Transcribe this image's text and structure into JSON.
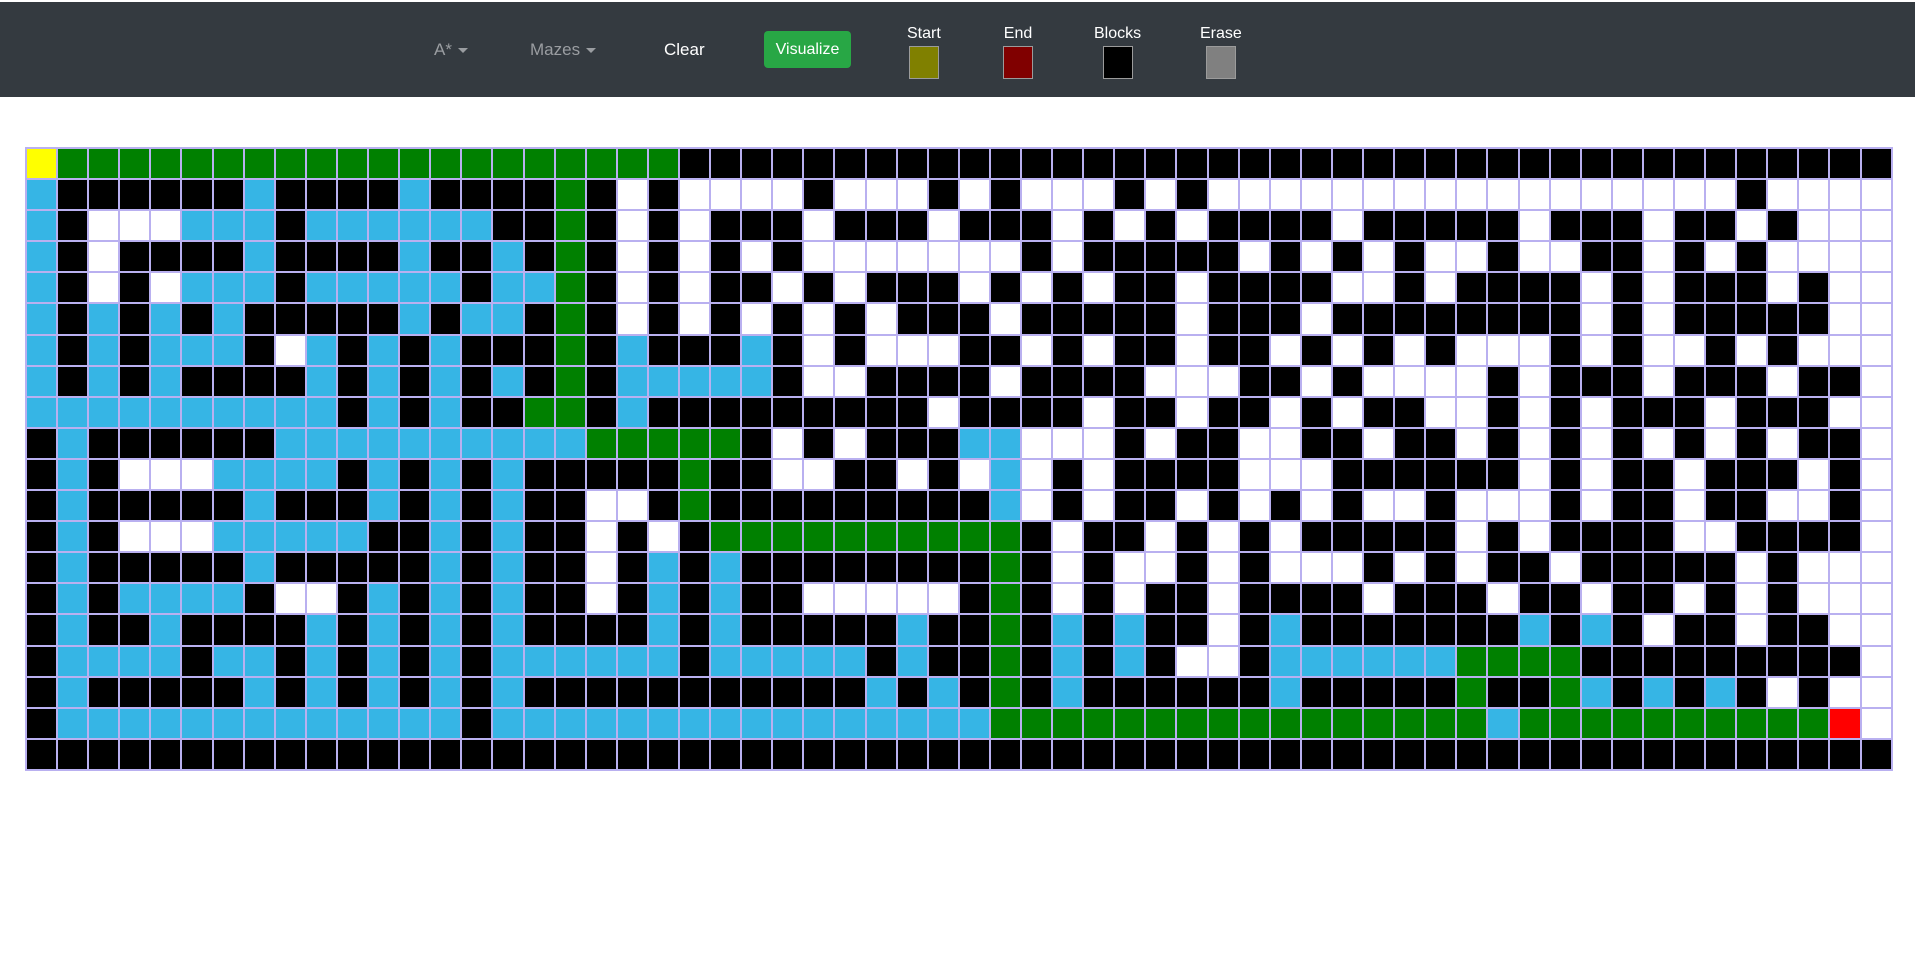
{
  "nav": {
    "algorithm_label": "A*",
    "mazes_label": "Mazes",
    "clear_label": "Clear",
    "visualize_label": "Visualize"
  },
  "legend": [
    {
      "label": "Start",
      "color": "#808000"
    },
    {
      "label": "End",
      "color": "#800000"
    },
    {
      "label": "Blocks",
      "color": "#000000"
    },
    {
      "label": "Erase",
      "color": "#808080"
    }
  ],
  "grid": {
    "cols": 60,
    "colors": {
      "S": "#ffff00",
      "E": "#ff0000",
      "P": "#008000",
      "V": "#36b5e5",
      "W": "#000000",
      ".": "#ffffff"
    },
    "rows": [
      "SPPPPPPPPPPPPPPPPPPPPWWWWWWWWWWWWWWWWWWWWWWWWWWWWWWWWWWWWWWW",
      "VWWWWWWVWWWWVWWWWPW.W....W...W.W...W.W.................W....",
      "VW...VVVWVVVVVVWWPW.W.WWW.WWW.WWW.W.W.WWWW.WWWWW.WWW.WW.W...",
      "VW.WWWWVWWWWVWWVWPW.W.W.W.......W.WWWWW.W.W.W..W..WW.W.W....",
      "VW.W.VVVWVVVVVWVVPW.W.WW.W.WWW.W.W.WW.WWWW..W.WWWW.W.WWW.W..",
      "VWVWVWVWWWWWVWVVWPW.W.W.W.W.WWW.WWWWW.WWW.WWWWWWWW.W.WWWWW..",
      "VWVWVVVW.VWVWVWWWPWVWWWVW.W...WW.W.WW.WW.W.W.W...W.W..W.W...",
      "VWVWVWWWWVWVWVWVWPWVVVVVW..WWWW.WWWW...WW.W....W.WWW.WWW.WW.",
      "VVVVVVVVVVWVWVWWPPWVWWWWWWWWW.WWWW.WW.WW.W.WW..W.W.WWW.WWW..",
      "WVWWWWWWVVVVVVVVVVPPPPPW.W.WWWVV...W.WW..WW.WW.W.W.W.W.W.WW.",
      "WVW...VVVVWVWVWVWWWWWPWW..WW.W.V.W.WWWW...WWWWWW.W.WW.WWW.W.",
      "WVWWWWWVWWWVWVWVWW..WPWWWWWWWWWV.W.WW.W.W.W..W...W.WW.WW..W.",
      "WVW...VVVVVWWVWVWW.W.WPPPPPPPPPPW.WW.W.W.WWWWW.W.WWWW..WWWW.",
      "WVWWWWWVWWWWWVWVWW.WVWVWWWWWWWWPW.W..W.W...W.W.WW.WWWWW.W...",
      "WVWVVVVW..WVWVWVWW.WVWVWW.....WPW.W.WW.WWWW.WWW.WW.WW.W.W...",
      "WVWWVWWWWVWVWVWVWWWWVWVWWWWWVWWPWVWVWW.WVWWWWWWWVWVW.WW.WW..",
      "WVVVVWVVWVWVWVWVVVVVVWVVVVVWVWWPWVWVW..WVVVVVVPPPPWWWWWWWWW.",
      "WVWWWWWVWVWVWVWVWWWWWWWWWWWVWVWPWVWWWWWWVWWWWWPWWPVWVWVW.W..",
      "WVVVVVVVVVVVVVWVVVVVVVVVVVVVVVVPPPPPPPPPPPPPPPPVPPPPPPPPPPE.",
      "WWWWWWWWWWWWWWWWWWWWWWWWWWWWWWWWWWWWWWWWWWWWWWWWWWWWWWWWWWWW"
    ]
  }
}
